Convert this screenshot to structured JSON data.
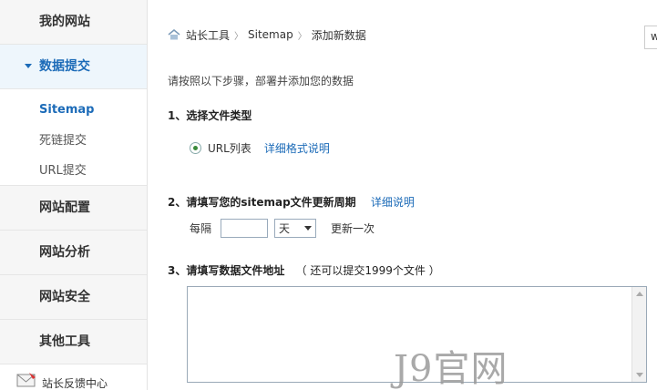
{
  "sidebar": {
    "items": [
      {
        "label": "我的网站"
      },
      {
        "label": "数据提交"
      },
      {
        "label": "网站配置"
      },
      {
        "label": "网站分析"
      },
      {
        "label": "网站安全"
      },
      {
        "label": "其他工具"
      }
    ],
    "sub_items": [
      {
        "label": "Sitemap"
      },
      {
        "label": "死链提交"
      },
      {
        "label": "URL提交"
      }
    ],
    "feedback_label": "站长反馈中心"
  },
  "breadcrumb": {
    "items": [
      "站长工具",
      "Sitemap",
      "添加新数据"
    ]
  },
  "top_input_value": "w",
  "intro": "请按照以下步骤，部署并添加您的数据",
  "step1": {
    "title": "1、选择文件类型",
    "option_label": "URL列表",
    "link": "详细格式说明"
  },
  "step2": {
    "title": "2、请填写您的sitemap文件更新周期",
    "link": "详细说明",
    "prefix": "每隔",
    "unit_selected": "天",
    "suffix": "更新一次"
  },
  "step3": {
    "title": "3、请填写数据文件地址",
    "note": "（ 还可以提交1999个文件 ）"
  },
  "watermark": "J9官网",
  "colors": {
    "accent": "#1c6bb8",
    "active_bg": "#eef6fc",
    "nav_bg": "#f6f6f6"
  }
}
